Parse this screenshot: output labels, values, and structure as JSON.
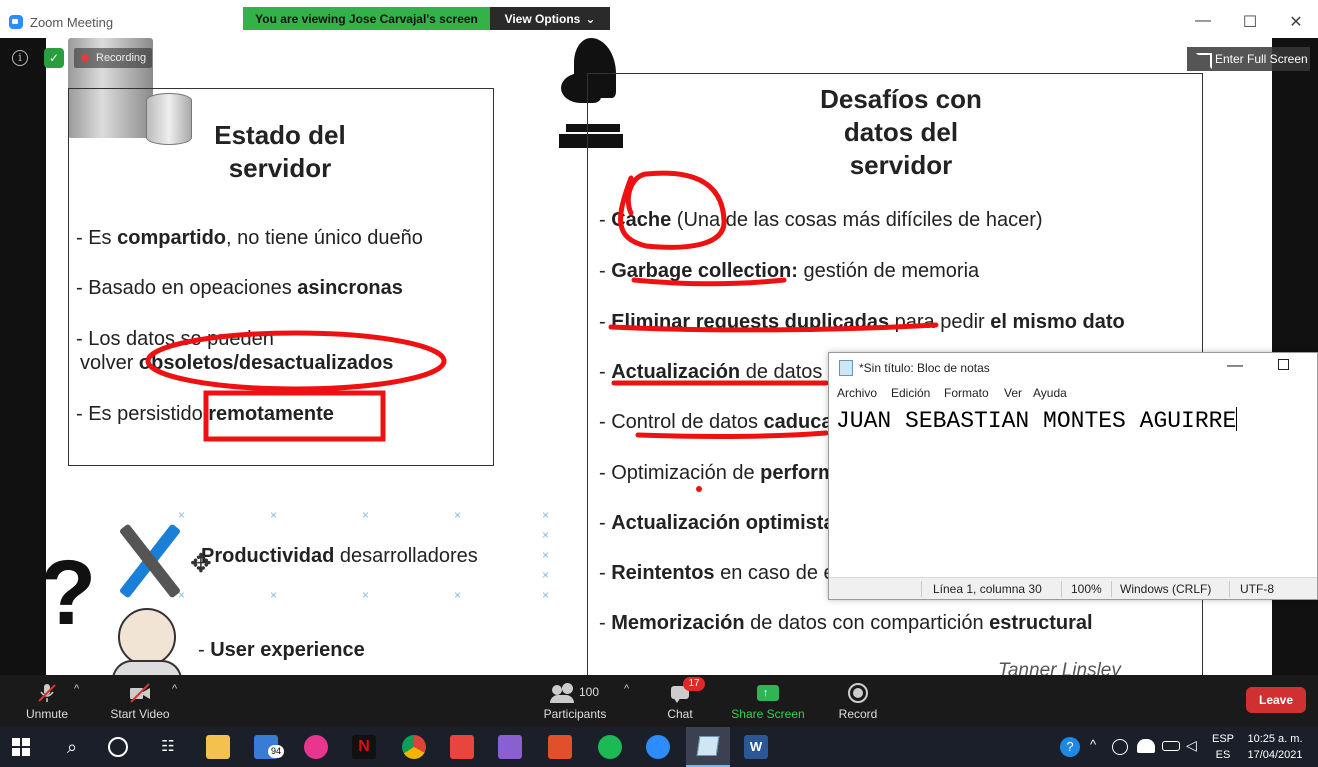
{
  "window": {
    "title": "Zoom Meeting",
    "viewing_banner": "You are viewing Jose Carvajal's screen",
    "view_options": "View Options",
    "minimize": "—",
    "maximize": "☐",
    "close": "✕"
  },
  "overlay": {
    "recording": "Recording",
    "enter_full_screen": "Enter Full Screen"
  },
  "slide": {
    "left": {
      "title": [
        "Estado del",
        "servidor"
      ],
      "bullets": [
        [
          "- Es ",
          "compartido",
          ", no tiene único dueño"
        ],
        [
          "- Basado en opeaciones ",
          "asincronas",
          ""
        ],
        [
          "- Los datos se pueden",
          "",
          ""
        ],
        [
          "volver ",
          "obsoletos/desactualizados",
          ""
        ],
        [
          "- Es persistido ",
          "remotamente",
          ""
        ]
      ],
      "extras": [
        [
          "",
          "Productividad",
          " desarrolladores"
        ],
        [
          "- ",
          "User experience",
          ""
        ]
      ]
    },
    "right": {
      "title": [
        "Desafíos con",
        "datos del",
        "servidor"
      ],
      "bullets": [
        [
          "- ",
          "Cache",
          " (Una de las cosas más difíciles de hacer)"
        ],
        [
          "- ",
          "Garbage collection:",
          " gestión de memoria"
        ],
        [
          "- ",
          "Eliminar requests duplicadas",
          " para pedir ",
          "el mismo dato"
        ],
        [
          "- ",
          "Actualización",
          " de datos"
        ],
        [
          "- Control de datos ",
          "caducados",
          ""
        ],
        [
          "- Optimización de ",
          "performance",
          ""
        ],
        [
          "- ",
          "Actualización optimista",
          ""
        ],
        [
          "- ",
          "Reintentos",
          " en caso de error"
        ],
        [
          "- ",
          "Memorización",
          " de datos con compartición ",
          "estructural"
        ]
      ],
      "credit": "Tanner Linsley"
    }
  },
  "notepad": {
    "title": "*Sin título: Bloc de notas",
    "menu": [
      "Archivo",
      "Edición",
      "Formato",
      "Ver",
      "Ayuda"
    ],
    "content": "JUAN SEBASTIAN MONTES AGUIRRE",
    "status": {
      "position": "Línea 1, columna 30",
      "zoom": "100%",
      "line_ending": "Windows (CRLF)",
      "encoding": "UTF-8"
    }
  },
  "toolbar": {
    "unmute": "Unmute",
    "start_video": "Start Video",
    "participants_count": "100",
    "participants": "Participants",
    "chat": "Chat",
    "chat_badge": "17",
    "share_screen": "Share Screen",
    "record": "Record",
    "leave": "Leave"
  },
  "taskbar": {
    "mail_badge": "94",
    "lang_top": "ESP",
    "lang_bottom": "ES",
    "time": "10:25 a. m.",
    "date": "17/04/2021"
  },
  "colors": {
    "zoom_green": "#34b24a",
    "annotation_red": "#ee1111",
    "leave_red": "#d0302f",
    "zoom_blue": "#2d8cff"
  }
}
